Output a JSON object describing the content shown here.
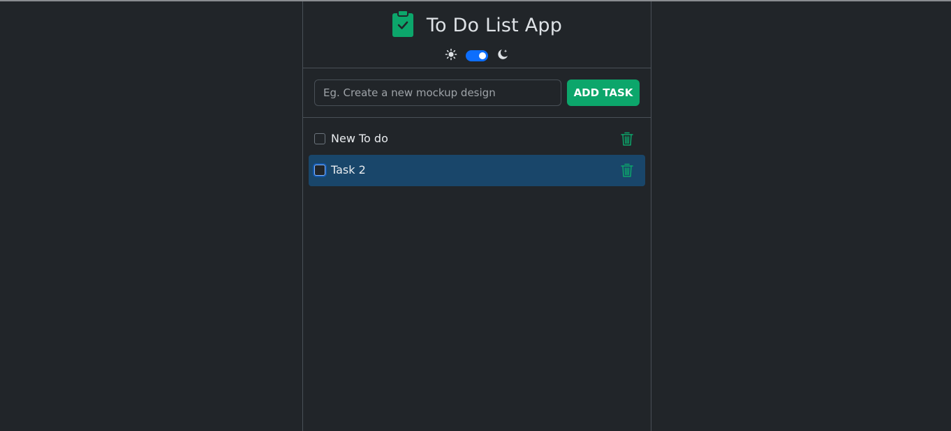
{
  "app": {
    "title": "To Do List App",
    "brand_color": "#0ca66b",
    "icon": "clipboard-check-icon"
  },
  "theme": {
    "light_icon": "sun-icon",
    "dark_icon": "moon-stars-icon",
    "dark_mode_enabled": true
  },
  "form": {
    "input_value": "",
    "input_placeholder": "Eg. Create a new mockup design",
    "add_button_label": "ADD TASK"
  },
  "tasks": [
    {
      "label": "New To do",
      "checked": false,
      "selected": false
    },
    {
      "label": "Task 2",
      "checked": false,
      "selected": true
    }
  ],
  "colors": {
    "background": "#212529",
    "selected_row": "#19466a",
    "toggle": "#0d6efd",
    "accent": "#0ca66b"
  }
}
